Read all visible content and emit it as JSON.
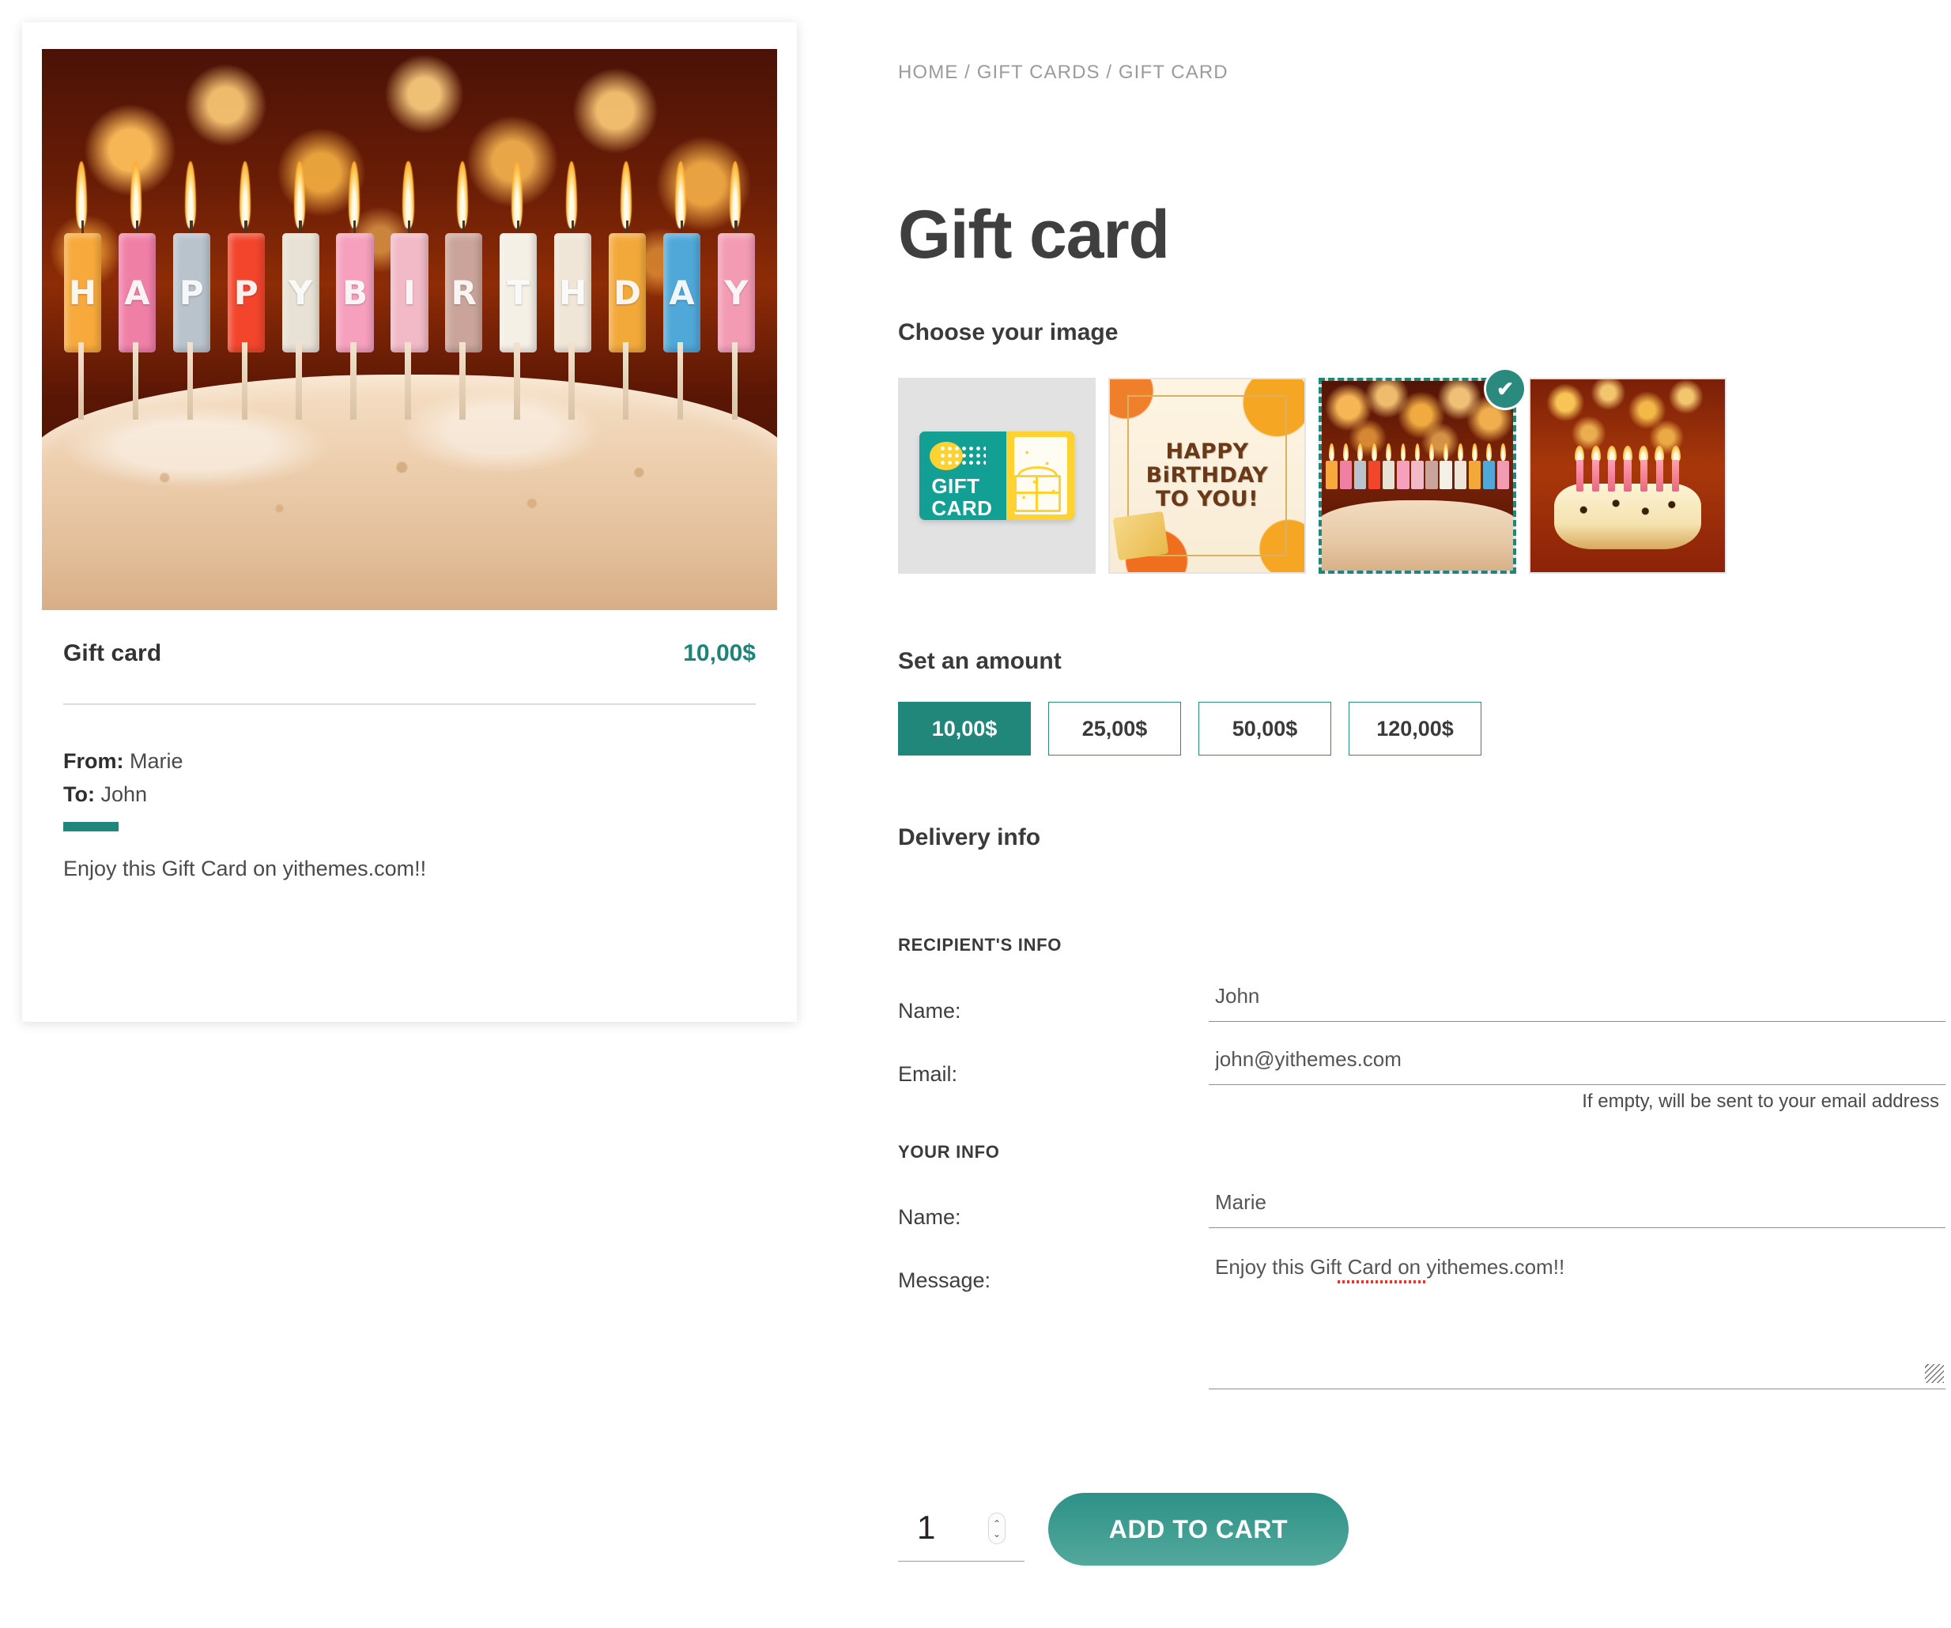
{
  "breadcrumb": {
    "items": [
      "HOME",
      "GIFT CARDS",
      "GIFT CARD"
    ],
    "text": "HOME / GIFT CARDS / GIFT CARD"
  },
  "page": {
    "title": "Gift card",
    "accent_color": "#22877b",
    "title_color": "#3f3f3f"
  },
  "preview": {
    "image_alt": "Happy birthday candles on cake",
    "product_name": "Gift card",
    "price": "10,00$",
    "from_label": "From:",
    "from_value": "Marie",
    "to_label": "To:",
    "to_value": "John",
    "message": "Enjoy this Gift Card on yithemes.com!!",
    "letters": [
      "H",
      "A",
      "P",
      "P",
      "Y",
      "B",
      "I",
      "R",
      "T",
      "H",
      "D",
      "A",
      "Y"
    ],
    "letter_colors": [
      "#f7a93b",
      "#f07fa6",
      "#b9c3cc",
      "#f2452c",
      "#e8e2d6",
      "#f6a0bd",
      "#f2b9c6",
      "#caa49a",
      "#f5f0e6",
      "#f0e6d8",
      "#f2a93a",
      "#4fa8d8",
      "#f49bb4"
    ]
  },
  "choose_image": {
    "heading": "Choose your image",
    "thumbnails": [
      {
        "name": "gift-card-graphic",
        "selected": false,
        "label_line1": "GIFT",
        "label_line2": "CARD"
      },
      {
        "name": "happy-birthday-to-you",
        "selected": false,
        "text_line1": "HAPPY",
        "text_line2": "BiRTHDAY",
        "text_line3": "TO YOU!"
      },
      {
        "name": "birthday-candles-cake",
        "selected": true,
        "check_glyph": "✔"
      },
      {
        "name": "star-cake-candles",
        "selected": false
      }
    ]
  },
  "amount": {
    "heading": "Set an amount",
    "options": [
      {
        "label": "10,00$",
        "selected": true
      },
      {
        "label": "25,00$",
        "selected": false
      },
      {
        "label": "50,00$",
        "selected": false
      },
      {
        "label": "120,00$",
        "selected": false
      }
    ]
  },
  "delivery": {
    "heading": "Delivery info",
    "recipient_subheading": "RECIPIENT'S INFO",
    "your_subheading": "YOUR INFO",
    "recipient_name_label": "Name:",
    "recipient_name_value": "John",
    "recipient_email_label": "Email:",
    "recipient_email_value": "john@yithemes.com",
    "email_hint": "If empty, will be sent to your email address",
    "your_name_label": "Name:",
    "your_name_value": "Marie",
    "message_label": "Message:",
    "message_value": "Enjoy this Gift Card on yithemes.com!!"
  },
  "cart": {
    "quantity": "1",
    "add_to_cart_label": "ADD TO CART",
    "spinner_up": "⌃",
    "spinner_down": "⌄"
  }
}
